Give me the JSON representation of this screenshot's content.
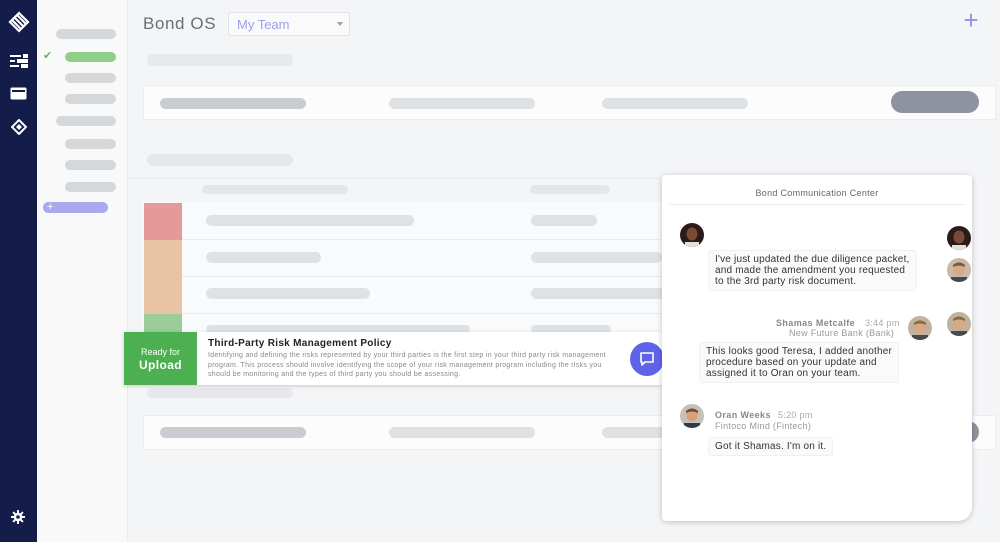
{
  "app": {
    "brand": "Bond OS",
    "team_selector": {
      "value": "My Team"
    },
    "add_button_label": "+"
  },
  "icons": {
    "logo": "bond-logo-icon",
    "rail": [
      "sliders-icon",
      "card-icon",
      "diamond-icon"
    ],
    "settings": "gear-icon",
    "chat": "chat-bubble-icon"
  },
  "subnav": {
    "add_label": "+"
  },
  "policy": {
    "status_line1": "Ready for",
    "status_line2": "Upload",
    "title": "Third-Party Risk Management Policy",
    "description": "Identifying and defining the risks represented by your third parties is the first step in your third party risk management program. This process should involve identifying the scope of your risk management program including the risks you should be monitoring and the types of third party you should be assessing."
  },
  "risk_colors": [
    "#e39a99",
    "#e8c4a4",
    "#e8c4a4",
    "#9ccc9a"
  ],
  "chat_panel": {
    "title": "Bond Communication Center",
    "messages": [
      {
        "lines": [
          "I've just updated the due diligence packet,",
          "and made the amendment you requested",
          "to the 3rd party risk document."
        ]
      },
      {
        "sender": "Shamas Metcalfe",
        "time": "3:44 pm",
        "org": "New Future Bank (Bank)",
        "lines": [
          "This looks good Teresa, I added another",
          "procedure based on your update and",
          "assigned it to Oran on your team."
        ]
      },
      {
        "sender": "Oran Weeks",
        "time": "5:20 pm",
        "org": "Fintoco Mind (Fintech)",
        "lines": [
          "Got it Shamas. I'm on it."
        ]
      }
    ]
  }
}
